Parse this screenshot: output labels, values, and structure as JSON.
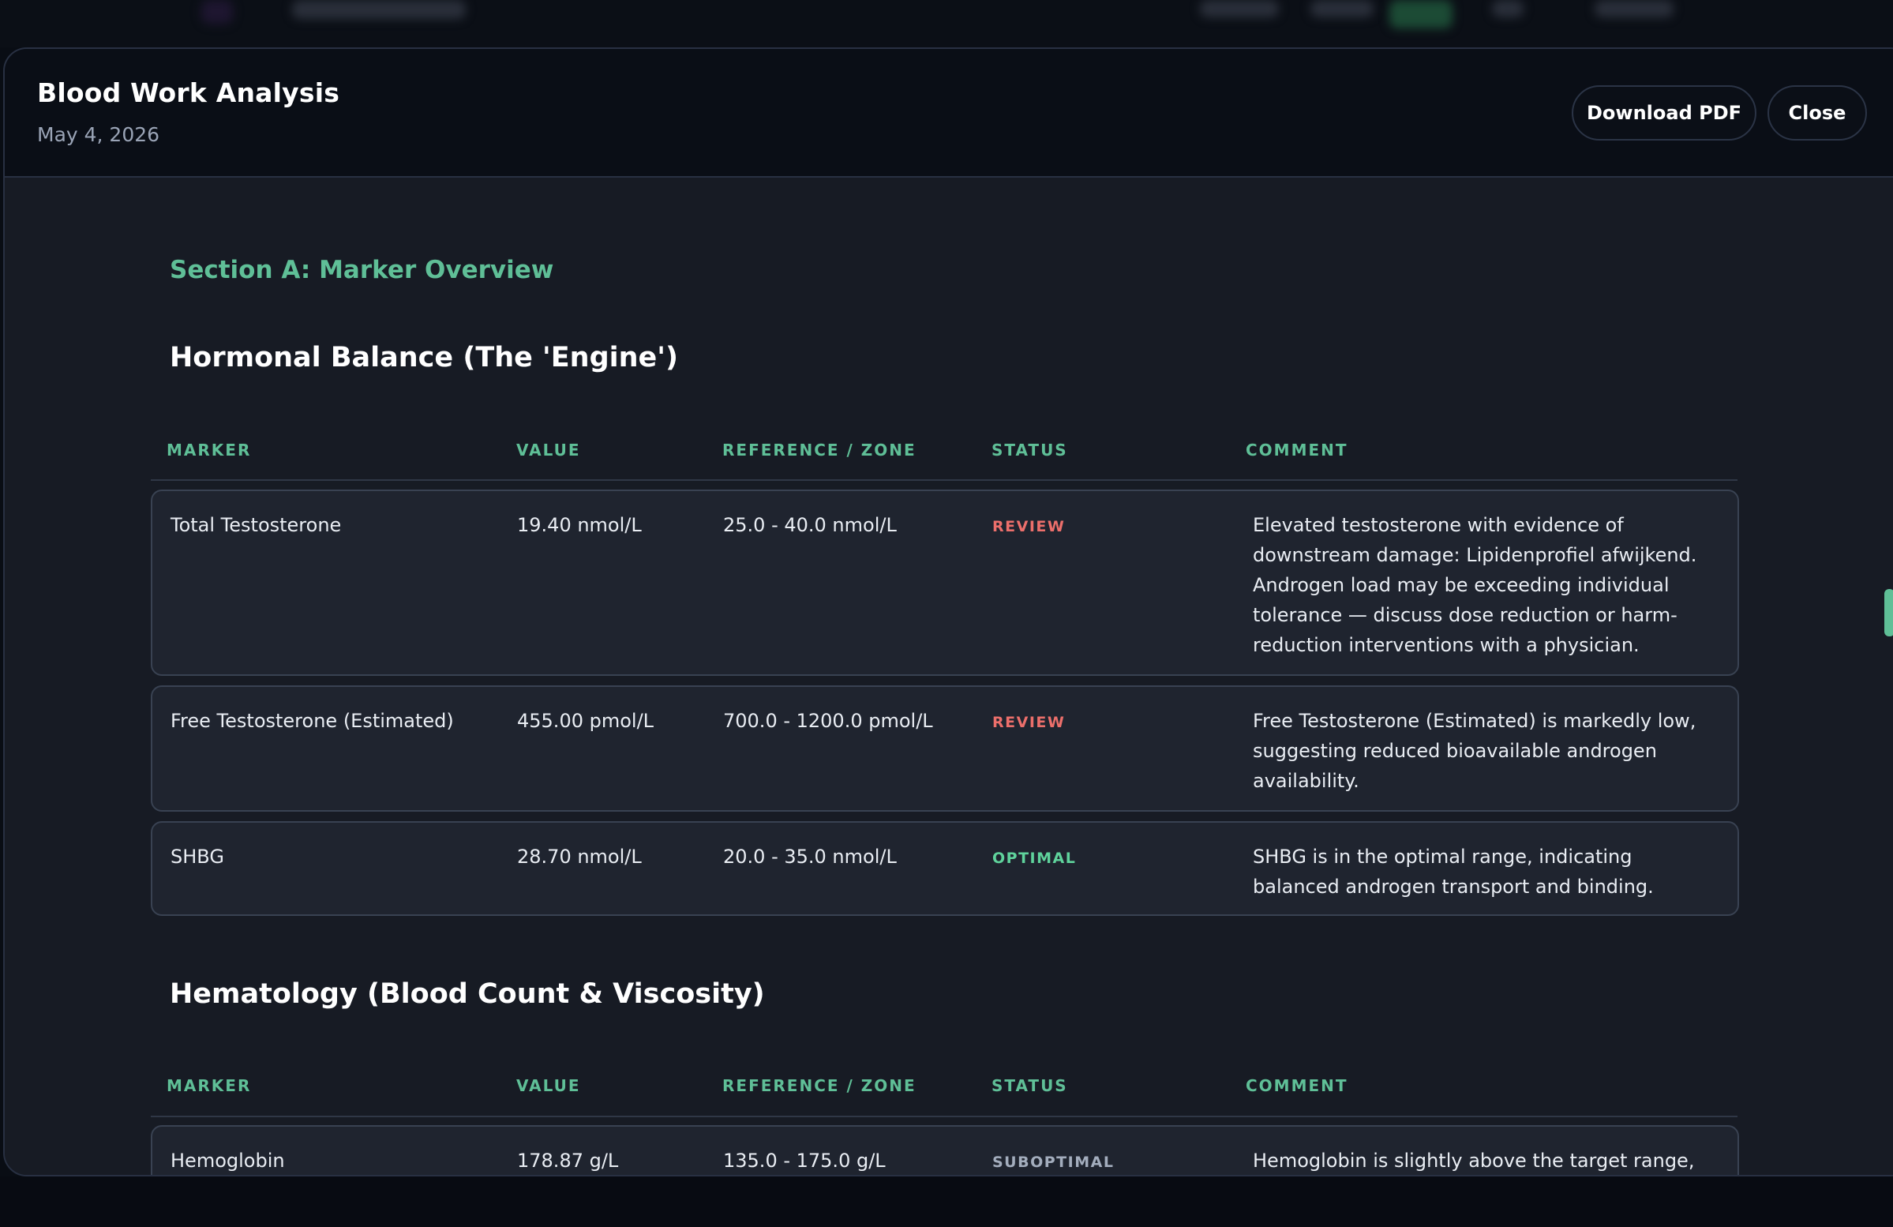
{
  "modal": {
    "title": "Blood Work Analysis",
    "date": "May 4, 2026",
    "download_label": "Download PDF",
    "close_label": "Close"
  },
  "section": {
    "title": "Section A: Marker Overview"
  },
  "columns": {
    "marker": "MARKER",
    "value": "VALUE",
    "reference": "REFERENCE / ZONE",
    "status": "STATUS",
    "comment": "COMMENT"
  },
  "groups": [
    {
      "title": "Hormonal Balance (The 'Engine')",
      "rows": [
        {
          "marker": "Total Testosterone",
          "value": "19.40 nmol/L",
          "reference": "25.0 - 40.0 nmol/L",
          "status": "REVIEW",
          "comment": "Elevated testosterone with evidence of downstream damage: Lipidenprofiel afwijkend. Androgen load may be exceeding individual tolerance — discuss dose reduction or harm-reduction interventions with a physician."
        },
        {
          "marker": "Free Testosterone (Estimated)",
          "value": "455.00 pmol/L",
          "reference": "700.0 - 1200.0 pmol/L",
          "status": "REVIEW",
          "comment": "Free Testosterone (Estimated) is markedly low, suggesting reduced bioavailable androgen availability."
        },
        {
          "marker": "SHBG",
          "value": "28.70 nmol/L",
          "reference": "20.0 - 35.0 nmol/L",
          "status": "OPTIMAL",
          "comment": "SHBG is in the optimal range, indicating balanced androgen transport and binding."
        }
      ]
    },
    {
      "title": "Hematology (Blood Count & Viscosity)",
      "rows": [
        {
          "marker": "Hemoglobin",
          "value": "178.87 g/L",
          "reference": "135.0 - 175.0 g/L",
          "status": "SUBOPTIMAL",
          "comment": "Hemoglobin is slightly above the target range, suggesting increased blood viscosity from greater red-cell mass."
        }
      ]
    }
  ],
  "colors": {
    "accent": "#5fbf97",
    "review": "#ec6f6b",
    "optimal": "#5fd39c",
    "suboptimal": "#a3adbd"
  }
}
